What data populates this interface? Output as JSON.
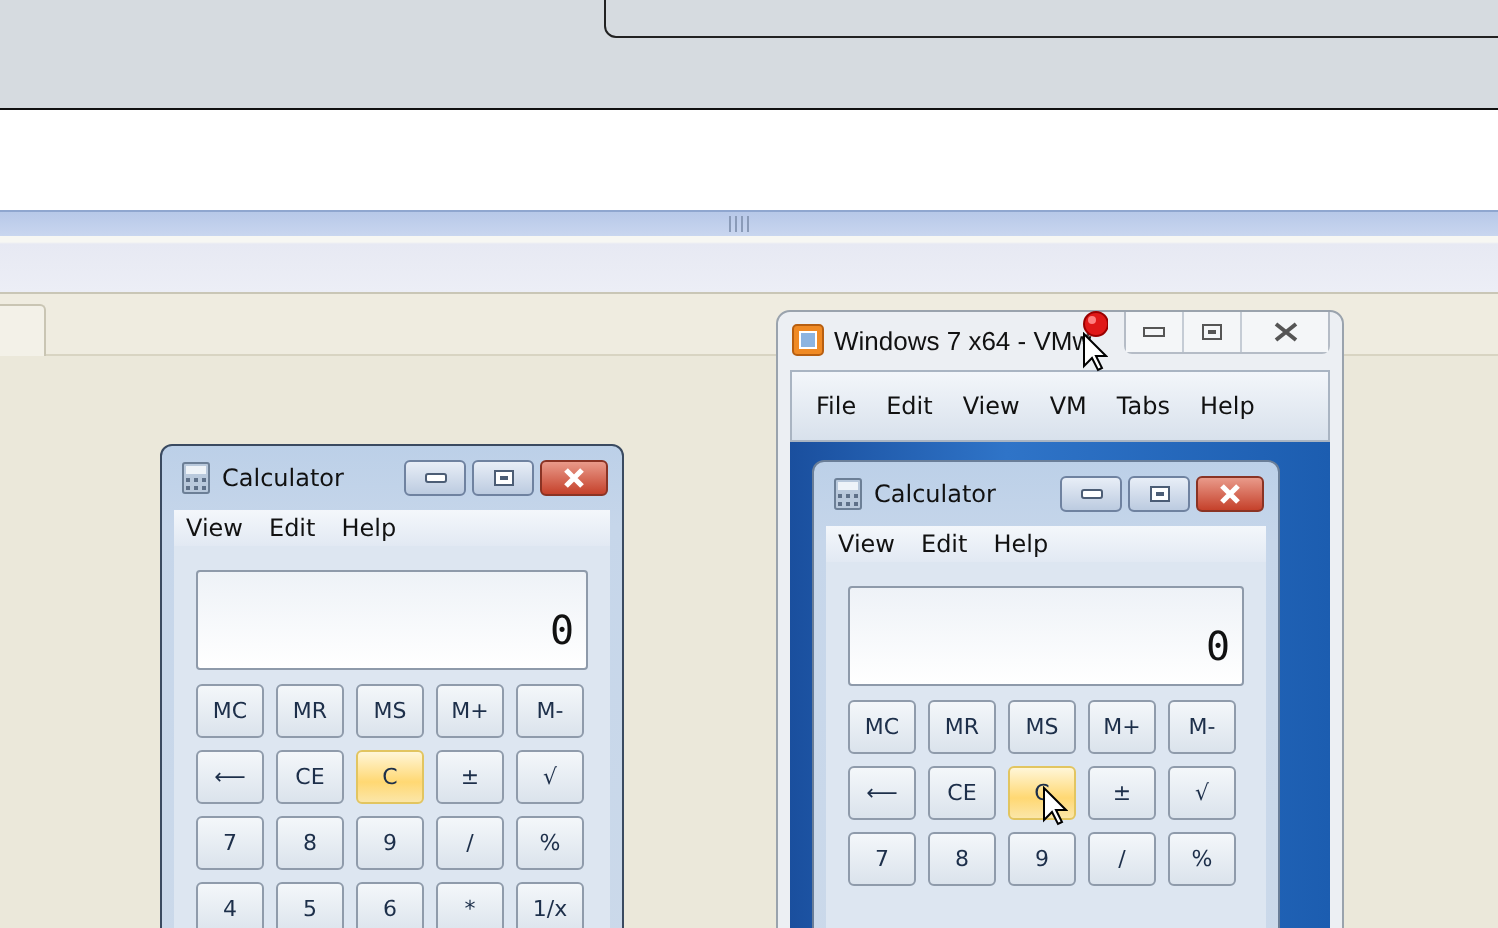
{
  "vm_window": {
    "title": "Windows 7 x64 - VMw",
    "menu": [
      "File",
      "Edit",
      "View",
      "VM",
      "Tabs",
      "Help"
    ]
  },
  "calculators": [
    {
      "title": "Calculator",
      "menu": [
        "View",
        "Edit",
        "Help"
      ],
      "display": "0",
      "keys": [
        [
          {
            "label": "MC",
            "highlighted": false
          },
          {
            "label": "MR",
            "highlighted": false
          },
          {
            "label": "MS",
            "highlighted": false
          },
          {
            "label": "M+",
            "highlighted": false
          },
          {
            "label": "M-",
            "highlighted": false
          }
        ],
        [
          {
            "label": "⟵",
            "highlighted": false
          },
          {
            "label": "CE",
            "highlighted": false
          },
          {
            "label": "C",
            "highlighted": true
          },
          {
            "label": "±",
            "highlighted": false
          },
          {
            "label": "√",
            "highlighted": false
          }
        ],
        [
          {
            "label": "7",
            "highlighted": false
          },
          {
            "label": "8",
            "highlighted": false
          },
          {
            "label": "9",
            "highlighted": false
          },
          {
            "label": "/",
            "highlighted": false
          },
          {
            "label": "%",
            "highlighted": false
          }
        ],
        [
          {
            "label": "4",
            "highlighted": false
          },
          {
            "label": "5",
            "highlighted": false
          },
          {
            "label": "6",
            "highlighted": false
          },
          {
            "label": "*",
            "highlighted": false
          },
          {
            "label": "1/x",
            "highlighted": false
          }
        ]
      ]
    },
    {
      "title": "Calculator",
      "menu": [
        "View",
        "Edit",
        "Help"
      ],
      "display": "0",
      "keys": [
        [
          {
            "label": "MC",
            "highlighted": false
          },
          {
            "label": "MR",
            "highlighted": false
          },
          {
            "label": "MS",
            "highlighted": false
          },
          {
            "label": "M+",
            "highlighted": false
          },
          {
            "label": "M-",
            "highlighted": false
          }
        ],
        [
          {
            "label": "⟵",
            "highlighted": false
          },
          {
            "label": "CE",
            "highlighted": false
          },
          {
            "label": "C",
            "highlighted": true
          },
          {
            "label": "±",
            "highlighted": false
          },
          {
            "label": "√",
            "highlighted": false
          }
        ],
        [
          {
            "label": "7",
            "highlighted": false
          },
          {
            "label": "8",
            "highlighted": false
          },
          {
            "label": "9",
            "highlighted": false
          },
          {
            "label": "/",
            "highlighted": false
          },
          {
            "label": "%",
            "highlighted": false
          }
        ]
      ]
    }
  ]
}
